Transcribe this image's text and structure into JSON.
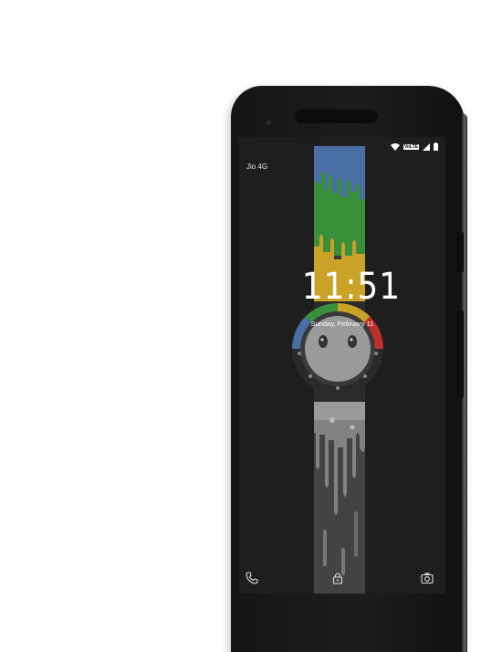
{
  "status_bar": {
    "carrier": "Jio 4G",
    "network_badge": "VoLTE",
    "icons": [
      "wifi-icon",
      "volte-icon",
      "signal-icon",
      "battery-icon"
    ]
  },
  "lock_screen": {
    "time": "11:51",
    "date": "Sunday, February 11"
  },
  "bottom_actions": [
    "phone-icon",
    "lock-icon",
    "camera-icon"
  ],
  "colors": {
    "blue": "#4a6fa5",
    "green": "#3a8f3a",
    "yellow": "#c9a227",
    "red": "#c0302a",
    "gray": "#8a8a8a",
    "screen_bg": "#1e1e1e"
  }
}
